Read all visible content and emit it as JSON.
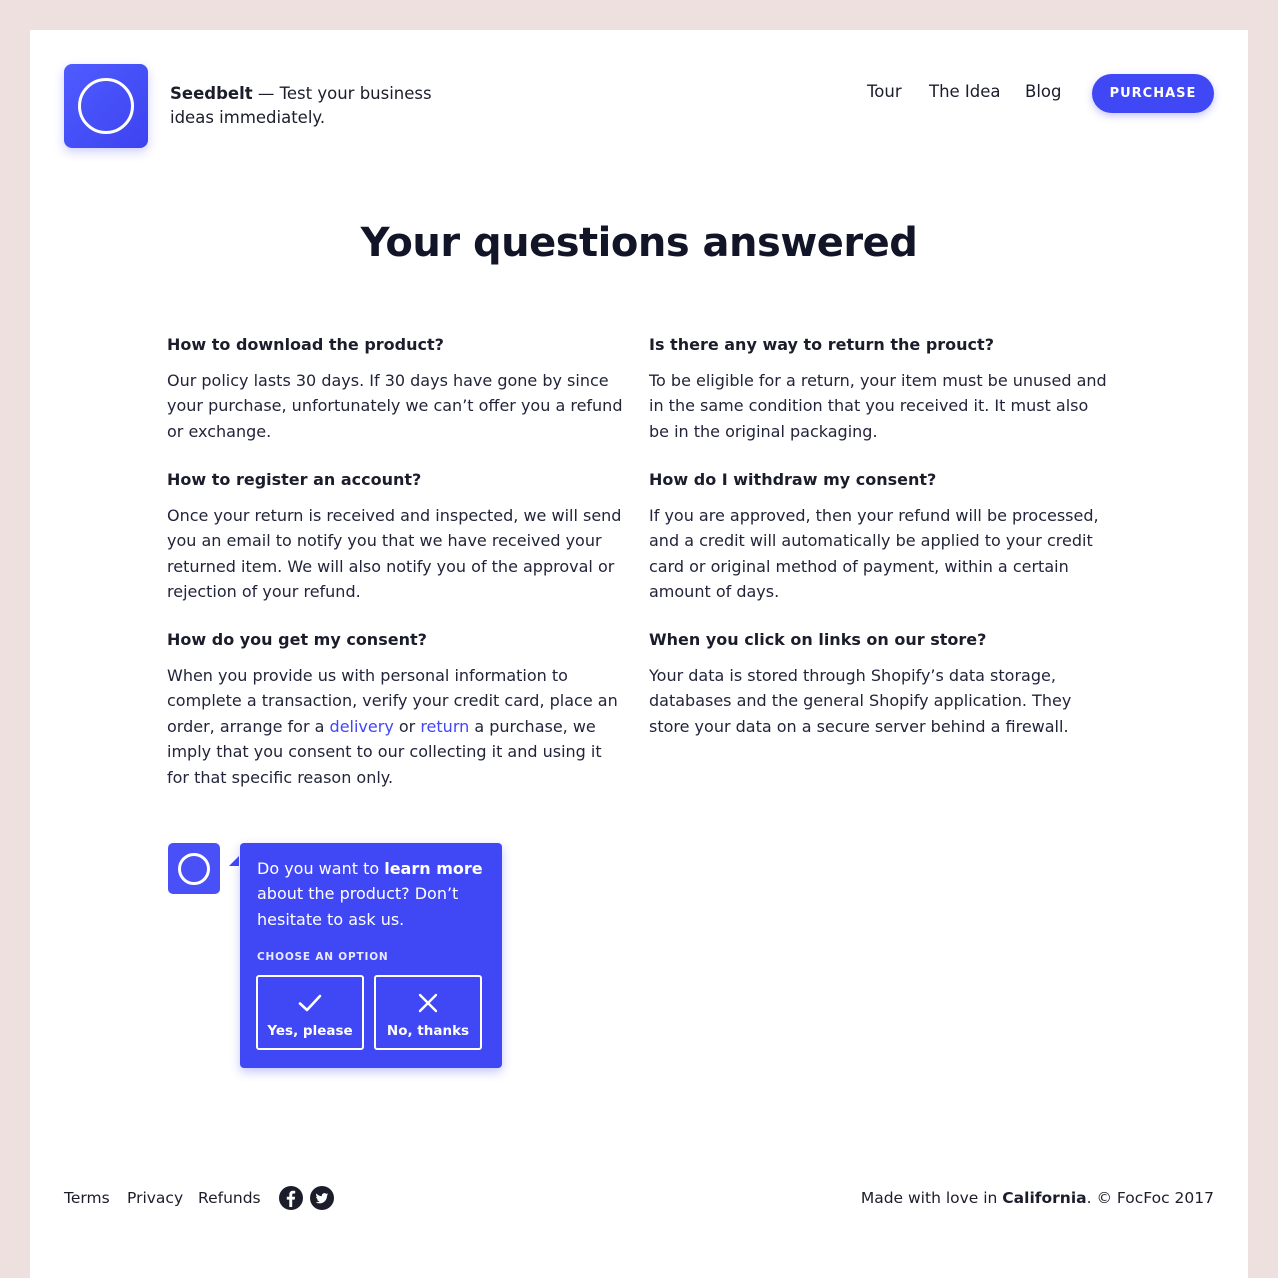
{
  "header": {
    "brand": "Seedbelt",
    "tagline": " — Test your business ideas immediately.",
    "nav": [
      {
        "label": "Tour"
      },
      {
        "label": "The Idea"
      },
      {
        "label": "Blog"
      }
    ],
    "purchase_label": "PURCHASE"
  },
  "main": {
    "title": "Your questions answered",
    "faq": [
      {
        "question": "How to download the product?",
        "answer": "Our policy lasts 30 days. If 30 days have gone by since your purchase, unfortunately we can’t offer you a refund or exchange."
      },
      {
        "question": "Is there any way to return the prouct?",
        "answer": "To be eligible for a return, your item must be unused and in the same condition that you received it. It must also be in the original packaging."
      },
      {
        "question": "How to register an account?",
        "answer": "Once your return is received and inspected, we will send you an email to notify you that we have received your returned item. We will also notify you of the approval or rejection of your refund."
      },
      {
        "question": "How do I withdraw my consent?",
        "answer": "If you are approved, then your refund will be processed, and a credit will automatically be applied to your credit card or original method of payment, within a certain amount of days."
      },
      {
        "question": "How do you get my consent?",
        "answer_part1": "When you provide us with personal information to complete a transaction, verify your credit card, place an order, arrange for a ",
        "link_delivery": "delivery",
        "answer_part2": " or ",
        "link_return": "return",
        "answer_part3": " a purchase, we imply that you consent to our collecting it and using it for that specific reason only."
      },
      {
        "question": "When you click on links on our store?",
        "answer": "Your data is stored through Shopify’s data storage, databases and the general Shopify application. They store your data on a secure server behind a firewall."
      }
    ]
  },
  "chat": {
    "text_part1": "Do you want to ",
    "text_bold": "learn more",
    "text_part2": " about the product? Don’t hesitate to ask us.",
    "choose_label": "CHOOSE AN OPTION",
    "yes_label": "Yes, please",
    "no_label": "No, thanks"
  },
  "footer": {
    "links": [
      {
        "label": "Terms"
      },
      {
        "label": "Privacy"
      },
      {
        "label": "Refunds"
      }
    ],
    "social_icons": [
      "facebook-icon",
      "twitter-icon"
    ],
    "made_part1": "Made with love in ",
    "made_bold": "California",
    "made_part2": ". © FocFoc 2017"
  },
  "colors": {
    "accent": "#4047f5",
    "background": "#efe0e0",
    "text": "#1b1d2b"
  }
}
